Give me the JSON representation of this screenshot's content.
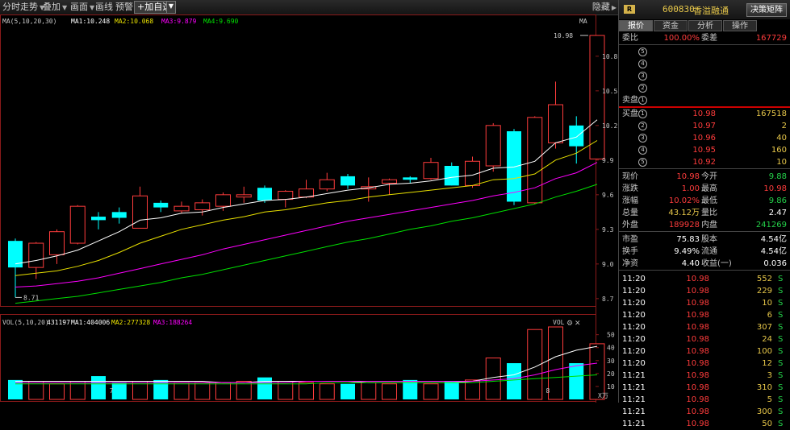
{
  "toolbar": {
    "items": [
      "分时走势",
      "叠加",
      "画面",
      "画线",
      "预警"
    ],
    "add_label": "+加自选",
    "hide_label": "隐藏"
  },
  "chart": {
    "ma_header": {
      "prefix": "MA(5,10,20,30)",
      "ma1": "MA1:10.248",
      "ma2": "MA2:10.068",
      "ma3": "MA3:9.879",
      "ma4": "MA4:9.690",
      "right": "MA"
    },
    "vol_header": {
      "prefix": "VOL(5,10,20)",
      "val": "431197",
      "ma1": "MA1:404006",
      "ma2": "MA2:277328",
      "ma3": "MA3:188264",
      "right": "VOL"
    },
    "price_ticks": [
      "10.8",
      "10.5",
      "10.2",
      "9.9",
      "9.6",
      "9.3",
      "9.0",
      "8.7"
    ],
    "vol_ticks": [
      "50",
      "40",
      "30",
      "20",
      "10"
    ],
    "vol_unit": "X万",
    "high_label": "10.98",
    "low_label": "8.71",
    "x_labels": [
      "7",
      "8"
    ],
    "colors": {
      "up": "#ff3c3c",
      "down": "#00ffff",
      "ma1": "#ffffff",
      "ma2": "#e8e000",
      "ma3": "#ff00ff",
      "ma4": "#00e000"
    }
  },
  "chart_data": {
    "type": "candlestick",
    "ylim": [
      8.65,
      11.05
    ],
    "vol_ylim": [
      0,
      56
    ],
    "candles": [
      {
        "o": 9.2,
        "c": 8.97,
        "h": 9.22,
        "l": 8.71,
        "v": 15,
        "up": false
      },
      {
        "o": 8.97,
        "c": 9.18,
        "h": 9.19,
        "l": 8.87,
        "v": 14,
        "up": true
      },
      {
        "o": 9.08,
        "c": 9.28,
        "h": 9.3,
        "l": 9.0,
        "v": 12,
        "up": true
      },
      {
        "o": 9.18,
        "c": 9.5,
        "h": 9.51,
        "l": 9.17,
        "v": 14,
        "up": true
      },
      {
        "o": 9.41,
        "c": 9.38,
        "h": 9.45,
        "l": 9.3,
        "v": 18,
        "up": false
      },
      {
        "o": 9.45,
        "c": 9.4,
        "h": 9.49,
        "l": 9.35,
        "v": 13,
        "up": false
      },
      {
        "o": 9.31,
        "c": 9.59,
        "h": 9.67,
        "l": 9.31,
        "v": 14,
        "up": true
      },
      {
        "o": 9.53,
        "c": 9.49,
        "h": 9.55,
        "l": 9.45,
        "v": 15,
        "up": false
      },
      {
        "o": 9.46,
        "c": 9.5,
        "h": 9.54,
        "l": 9.44,
        "v": 13,
        "up": true
      },
      {
        "o": 9.47,
        "c": 9.53,
        "h": 9.56,
        "l": 9.42,
        "v": 13,
        "up": true
      },
      {
        "o": 9.5,
        "c": 9.6,
        "h": 9.62,
        "l": 9.46,
        "v": 13,
        "up": true
      },
      {
        "o": 9.58,
        "c": 9.6,
        "h": 9.67,
        "l": 9.53,
        "v": 14,
        "up": true
      },
      {
        "o": 9.66,
        "c": 9.55,
        "h": 9.68,
        "l": 9.53,
        "v": 17,
        "up": false
      },
      {
        "o": 9.56,
        "c": 9.63,
        "h": 9.64,
        "l": 9.49,
        "v": 14,
        "up": true
      },
      {
        "o": 9.58,
        "c": 9.65,
        "h": 9.73,
        "l": 9.57,
        "v": 13,
        "up": true
      },
      {
        "o": 9.65,
        "c": 9.73,
        "h": 9.79,
        "l": 9.63,
        "v": 12,
        "up": true
      },
      {
        "o": 9.76,
        "c": 9.68,
        "h": 9.78,
        "l": 9.65,
        "v": 12,
        "up": false
      },
      {
        "o": 9.65,
        "c": 9.67,
        "h": 9.75,
        "l": 9.54,
        "v": 13,
        "up": true
      },
      {
        "o": 9.7,
        "c": 9.73,
        "h": 9.74,
        "l": 9.6,
        "v": 12,
        "up": true
      },
      {
        "o": 9.73,
        "c": 9.75,
        "h": 9.76,
        "l": 9.7,
        "v": 15,
        "up": false
      },
      {
        "o": 9.74,
        "c": 9.88,
        "h": 9.92,
        "l": 9.73,
        "v": 12,
        "up": true
      },
      {
        "o": 9.85,
        "c": 9.68,
        "h": 9.88,
        "l": 9.68,
        "v": 14,
        "up": false
      },
      {
        "o": 9.68,
        "c": 9.89,
        "h": 9.93,
        "l": 9.66,
        "v": 15,
        "up": true
      },
      {
        "o": 9.85,
        "c": 10.2,
        "h": 10.22,
        "l": 9.8,
        "v": 32,
        "up": true
      },
      {
        "o": 10.15,
        "c": 9.54,
        "h": 10.17,
        "l": 9.51,
        "v": 28,
        "up": false
      },
      {
        "o": 9.53,
        "c": 10.27,
        "h": 10.28,
        "l": 9.52,
        "v": 54,
        "up": true
      },
      {
        "o": 10.05,
        "c": 10.38,
        "h": 10.58,
        "l": 10.0,
        "v": 56,
        "up": true
      },
      {
        "o": 10.2,
        "c": 10.02,
        "h": 10.28,
        "l": 9.87,
        "v": 28,
        "up": false
      },
      {
        "o": 9.91,
        "c": 10.98,
        "h": 10.98,
        "l": 9.91,
        "v": 43,
        "up": true
      }
    ],
    "ma": {
      "ma1": [
        9.0,
        9.03,
        9.07,
        9.12,
        9.2,
        9.28,
        9.38,
        9.4,
        9.44,
        9.45,
        9.49,
        9.52,
        9.55,
        9.56,
        9.58,
        9.61,
        9.64,
        9.66,
        9.69,
        9.7,
        9.72,
        9.75,
        9.77,
        9.83,
        9.84,
        9.89,
        10.05,
        10.1,
        10.25
      ],
      "ma2": [
        8.9,
        8.92,
        8.94,
        8.98,
        9.03,
        9.1,
        9.18,
        9.24,
        9.3,
        9.34,
        9.38,
        9.41,
        9.45,
        9.47,
        9.5,
        9.53,
        9.55,
        9.58,
        9.6,
        9.62,
        9.64,
        9.66,
        9.68,
        9.73,
        9.74,
        9.78,
        9.9,
        9.96,
        10.07
      ],
      "ma3": [
        8.8,
        8.81,
        8.83,
        8.85,
        8.88,
        8.92,
        8.96,
        9.0,
        9.04,
        9.08,
        9.13,
        9.17,
        9.21,
        9.25,
        9.29,
        9.33,
        9.37,
        9.4,
        9.43,
        9.46,
        9.49,
        9.52,
        9.55,
        9.59,
        9.62,
        9.66,
        9.74,
        9.79,
        9.88
      ],
      "ma4": [
        8.66,
        8.68,
        8.7,
        8.72,
        8.75,
        8.78,
        8.81,
        8.84,
        8.88,
        8.91,
        8.95,
        8.99,
        9.03,
        9.07,
        9.11,
        9.15,
        9.19,
        9.22,
        9.26,
        9.3,
        9.33,
        9.37,
        9.4,
        9.44,
        9.48,
        9.52,
        9.58,
        9.63,
        9.69
      ]
    },
    "vol_ma": {
      "ma1": [
        14,
        14,
        14,
        14,
        14,
        14,
        14,
        14,
        14,
        14,
        13,
        13,
        14,
        14,
        14,
        14,
        14,
        13,
        13,
        13,
        13,
        13,
        14,
        17,
        19,
        25,
        33,
        38,
        41
      ],
      "ma2": [
        13,
        13,
        13,
        13,
        13,
        13,
        13,
        13,
        13,
        13,
        13,
        13,
        13,
        13,
        14,
        14,
        14,
        14,
        14,
        14,
        14,
        14,
        14,
        15,
        16,
        19,
        23,
        26,
        28
      ],
      "ma3": [
        12,
        12,
        12,
        12,
        12,
        12,
        12,
        12,
        12,
        12,
        12,
        12,
        12,
        12,
        12,
        13,
        13,
        13,
        13,
        13,
        13,
        13,
        13,
        14,
        15,
        16,
        17,
        18,
        19
      ]
    }
  },
  "panel": {
    "badge": "R",
    "code": "600830",
    "name": "香溢融通",
    "button": "决策矩阵",
    "tabs": [
      "报价",
      "资金",
      "分析",
      "操作"
    ],
    "weibi": {
      "label1": "委比",
      "val1": "100.00%",
      "label2": "委差",
      "val2": "167729"
    },
    "sell": [
      {
        "n": "5",
        "label": ""
      },
      {
        "n": "4",
        "label": ""
      },
      {
        "n": "3",
        "label": ""
      },
      {
        "n": "2",
        "label": ""
      },
      {
        "n": "1",
        "label": "卖盘"
      }
    ],
    "buy": [
      {
        "label": "买盘",
        "n": "1",
        "price": "10.98",
        "vol": "167518"
      },
      {
        "label": "",
        "n": "2",
        "price": "10.97",
        "vol": "2"
      },
      {
        "label": "",
        "n": "3",
        "price": "10.96",
        "vol": "40"
      },
      {
        "label": "",
        "n": "4",
        "price": "10.95",
        "vol": "160"
      },
      {
        "label": "",
        "n": "5",
        "price": "10.92",
        "vol": "10"
      }
    ],
    "quotes": [
      {
        "l1": "现价",
        "v1": "10.98",
        "c1": "red",
        "l2": "今开",
        "v2": "9.88",
        "c2": "green"
      },
      {
        "l1": "涨跌",
        "v1": "1.00",
        "c1": "red",
        "l2": "最高",
        "v2": "10.98",
        "c2": "red"
      },
      {
        "l1": "涨幅",
        "v1": "10.02%",
        "c1": "red",
        "l2": "最低",
        "v2": "9.86",
        "c2": "green"
      },
      {
        "l1": "总量",
        "v1": "43.12万",
        "c1": "yel",
        "l2": "量比",
        "v2": "2.47",
        "c2": "white"
      },
      {
        "l1": "外盘",
        "v1": "189928",
        "c1": "red",
        "l2": "内盘",
        "v2": "241269",
        "c2": "green"
      }
    ],
    "stats": [
      {
        "l1": "市盈",
        "v1": "75.83",
        "l2": "股本",
        "v2": "4.54亿"
      },
      {
        "l1": "换手",
        "v1": "9.49%",
        "l2": "流通",
        "v2": "4.54亿"
      },
      {
        "l1": "净资",
        "v1": "4.40",
        "l2": "收益(一)",
        "v2": "0.036"
      }
    ],
    "trades": [
      {
        "t": "11:20",
        "p": "10.98",
        "v": "552",
        "s": "S"
      },
      {
        "t": "11:20",
        "p": "10.98",
        "v": "229",
        "s": "S"
      },
      {
        "t": "11:20",
        "p": "10.98",
        "v": "10",
        "s": "S"
      },
      {
        "t": "11:20",
        "p": "10.98",
        "v": "6",
        "s": "S"
      },
      {
        "t": "11:20",
        "p": "10.98",
        "v": "307",
        "s": "S"
      },
      {
        "t": "11:20",
        "p": "10.98",
        "v": "24",
        "s": "S"
      },
      {
        "t": "11:20",
        "p": "10.98",
        "v": "100",
        "s": "S"
      },
      {
        "t": "11:20",
        "p": "10.98",
        "v": "12",
        "s": "S"
      },
      {
        "t": "11:21",
        "p": "10.98",
        "v": "3",
        "s": "S"
      },
      {
        "t": "11:21",
        "p": "10.98",
        "v": "310",
        "s": "S"
      },
      {
        "t": "11:21",
        "p": "10.98",
        "v": "5",
        "s": "S"
      },
      {
        "t": "11:21",
        "p": "10.98",
        "v": "300",
        "s": "S"
      },
      {
        "t": "11:21",
        "p": "10.98",
        "v": "50",
        "s": "S"
      }
    ]
  }
}
